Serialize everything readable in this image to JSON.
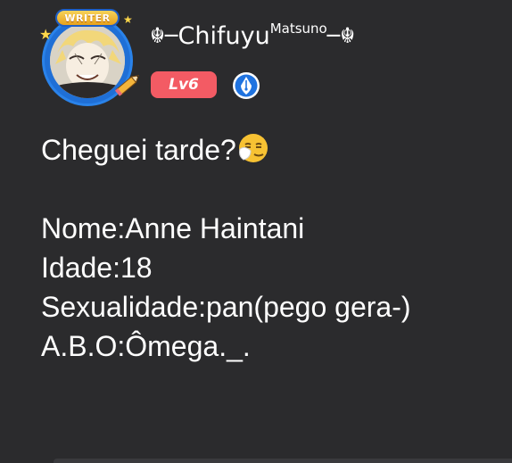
{
  "header": {
    "badge_text": "WRITER",
    "username_deco_left": "☬─",
    "username_main": "Chifuyu",
    "username_sup": "Matsuno",
    "username_deco_right": "─☬",
    "level": "Lv6",
    "icons": {
      "avatar": "avatar-icon",
      "pencil": "pencil-icon",
      "role": "fountain-pen-icon",
      "stars": "star-icon"
    }
  },
  "post": {
    "line1": "Cheguei tarde?",
    "emoji": "sneezing-face-icon",
    "lines": [
      "Nome:Anne Haintani",
      "Idade:18",
      "Sexualidade:pan(pego gera-)",
      "A.B.O:Ômega._."
    ]
  },
  "colors": {
    "background": "#2b2b2d",
    "level_badge": "#f35b64",
    "avatar_ring": "#2a83ea",
    "writer_badge": "#f0bf3a",
    "text": "#ffffff"
  }
}
